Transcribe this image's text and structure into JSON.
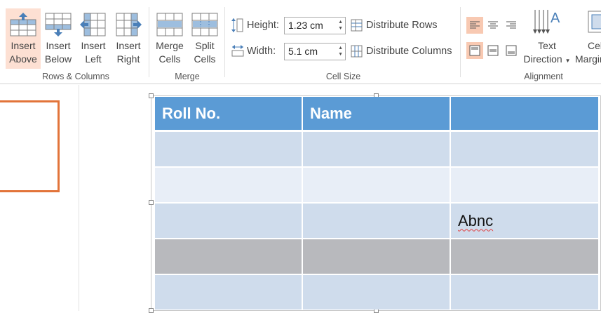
{
  "ribbon": {
    "rows_columns": {
      "label": "Rows & Columns",
      "insert_above": {
        "line1": "Insert",
        "line2": "Above"
      },
      "insert_below": {
        "line1": "Insert",
        "line2": "Below"
      },
      "insert_left": {
        "line1": "Insert",
        "line2": "Left"
      },
      "insert_right": {
        "line1": "Insert",
        "line2": "Right"
      }
    },
    "merge": {
      "label": "Merge",
      "merge_cells": {
        "line1": "Merge",
        "line2": "Cells"
      },
      "split_cells": {
        "line1": "Split",
        "line2": "Cells"
      }
    },
    "cell_size": {
      "label": "Cell Size",
      "height_label": "Height:",
      "height_value": "1.23 cm",
      "width_label": "Width:",
      "width_value": "5.1 cm",
      "distribute_rows": "Distribute Rows",
      "distribute_columns": "Distribute Columns"
    },
    "alignment": {
      "label": "Alignment",
      "text_direction": {
        "line1": "Text",
        "line2": "Direction"
      },
      "cell_margins": {
        "line1": "Cell",
        "line2": "Margins"
      }
    }
  },
  "table": {
    "headers": [
      "Roll No.",
      "Name",
      ""
    ],
    "rows": [
      [
        "",
        "",
        ""
      ],
      [
        "",
        "",
        ""
      ],
      [
        "",
        "",
        "Abnc"
      ],
      [
        "",
        "",
        ""
      ],
      [
        "",
        "",
        ""
      ]
    ]
  },
  "colors": {
    "accent_selected": "#fde0d3",
    "table_header": "#5b9bd5",
    "table_band": "#cfdcec",
    "thumbnail_border": "#e2743a"
  }
}
